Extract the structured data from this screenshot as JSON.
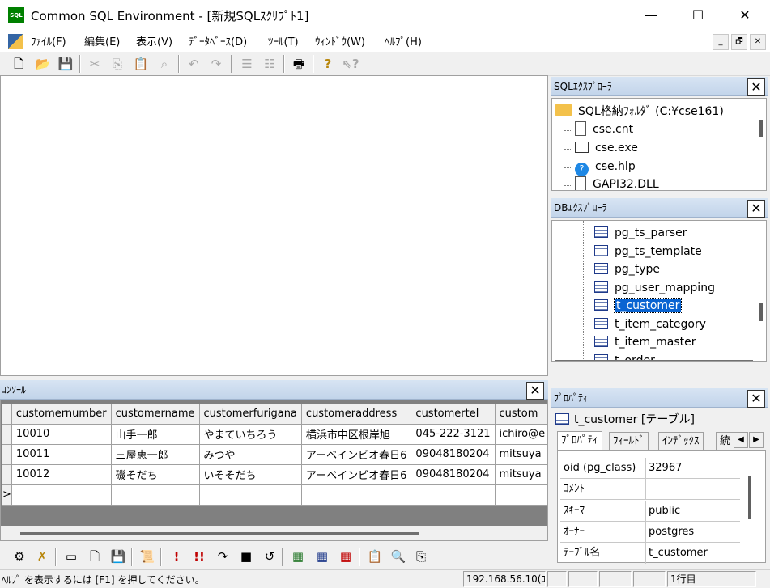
{
  "window": {
    "title": "Common SQL Environment - [新規SQLｽｸﾘﾌﾟﾄ1]",
    "app_icon": "SQL",
    "minimize": "—",
    "maximize": "☐",
    "close": "✕"
  },
  "menu": {
    "items": [
      "ﾌｧｲﾙ(F)",
      "編集(E)",
      "表示(V)",
      "ﾃﾞｰﾀﾍﾞｰｽ(D)",
      "ﾂｰﾙ(T)",
      "ｳｨﾝﾄﾞｳ(W)",
      "ﾍﾙﾌﾟ(H)"
    ],
    "mdi_min": "_",
    "mdi_restore": "🗗",
    "mdi_close": "✕"
  },
  "toolbar": {
    "icons": [
      "new-file-icon",
      "open-folder-icon",
      "save-icon",
      "cut-icon",
      "copy-icon",
      "paste-icon",
      "find-icon",
      "undo-icon",
      "redo-icon",
      "indent-icon",
      "outdent-icon",
      "print-icon",
      "help-icon",
      "context-help-icon"
    ]
  },
  "sql_explorer": {
    "title": "SQLｴｸｽﾌﾟﾛｰﾗ",
    "root": "SQL格納ﾌｫﾙﾀﾞ (C:¥cse161)",
    "files": [
      "cse.cnt",
      "cse.exe",
      "cse.hlp",
      "GAPI32.DLL"
    ]
  },
  "db_explorer": {
    "title": "DBｴｸｽﾌﾟﾛｰﾗ",
    "items": [
      "pg_ts_parser",
      "pg_ts_template",
      "pg_type",
      "pg_user_mapping",
      "t_customer",
      "t_item_category",
      "t_item_master",
      "t_order"
    ],
    "selected": "t_customer"
  },
  "console": {
    "title": "ｺﾝｿｰﾙ",
    "columns": [
      "customernumber",
      "customername",
      "customerfurigana",
      "customeraddress",
      "customertel",
      "custom"
    ],
    "rows": [
      [
        "10010",
        "山手一郎",
        "やまていちろう",
        "横浜市中区根岸旭",
        "045-222-3121",
        "ichiro@e"
      ],
      [
        "10011",
        "三屋恵一郎",
        "みつや",
        "アーベインビオ春日6",
        "09048180204",
        "mitsuya"
      ],
      [
        "10012",
        "磯そだち",
        "いそそだち",
        "アーベインビオ春日6",
        "09048180204",
        "mitsuya"
      ]
    ],
    "new_row_marker": ">"
  },
  "properties": {
    "title": "ﾌﾟﾛﾊﾟﾃｨ",
    "object": "t_customer [テーブル]",
    "tabs": [
      "ﾌﾟﾛﾊﾟﾃｨ",
      "ﾌｨｰﾙﾄﾞ",
      "ｲﾝﾃﾞｯｸｽ",
      "統"
    ],
    "rows": [
      {
        "name": "oid (pg_class)",
        "value": "32967"
      },
      {
        "name": "ｺﾒﾝﾄ",
        "value": ""
      },
      {
        "name": "ｽｷｰﾏ",
        "value": "public"
      },
      {
        "name": "ｵｰﾅｰ",
        "value": "postgres"
      },
      {
        "name": "ﾃｰﾌﾞﾙ名",
        "value": "t_customer"
      }
    ]
  },
  "status": {
    "help": "ﾍﾙﾌﾟ を表示するには [F1] を押してください。",
    "connection": "192.168.56.10(ﾕ",
    "line": "1行目"
  }
}
